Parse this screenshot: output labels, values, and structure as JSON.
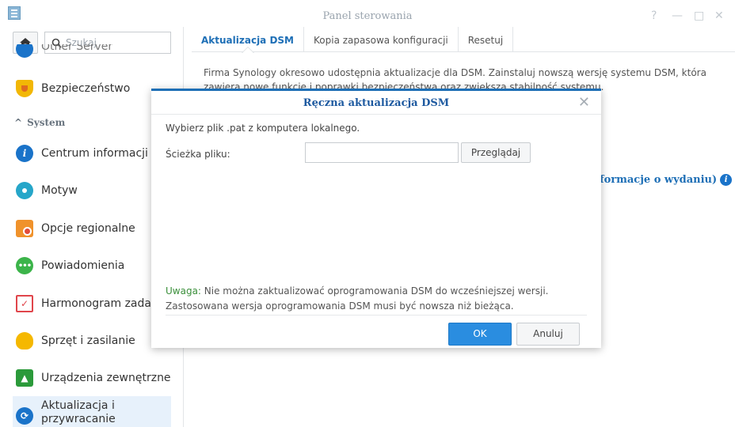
{
  "window": {
    "title": "Panel sterowania",
    "controls": {
      "help": "?",
      "minimize": "—",
      "maximize": "□",
      "close": "✕"
    }
  },
  "sidebar": {
    "search_placeholder": "Szukaj",
    "cut_item": "Other Server",
    "group_system": "System",
    "items": [
      {
        "label": "Bezpieczeństwo",
        "icon": "shield-icon",
        "color": "#f2b705"
      },
      {
        "label": "Centrum informacji",
        "icon": "info-icon",
        "color": "#1a73c9"
      },
      {
        "label": "Motyw",
        "icon": "palette-icon",
        "color": "#26a6c9"
      },
      {
        "label": "Opcje regionalne",
        "icon": "clock-icon",
        "color": "#f0922b"
      },
      {
        "label": "Powiadomienia",
        "icon": "chat-icon",
        "color": "#3cb44a"
      },
      {
        "label": "Harmonogram zadań",
        "icon": "calendar-icon",
        "color": "#e0454b"
      },
      {
        "label": "Sprzęt i zasilanie",
        "icon": "bulb-icon",
        "color": "#f5b800"
      },
      {
        "label": "Urządzenia zewnętrzne",
        "icon": "external-device-icon",
        "color": "#2b9a3a"
      },
      {
        "label": "Aktualizacja i przywracanie",
        "icon": "update-icon",
        "color": "#1a73c9"
      }
    ]
  },
  "main": {
    "tabs": [
      "Aktualizacja DSM",
      "Kopia zapasowa konfiguracji",
      "Resetuj"
    ],
    "description": "Firma Synology okresowo udostępnia aktualizacje dla DSM. Zainstaluj nowszą wersję systemu DSM, która zawiera nowe funkcje i poprawki bezpieczeństwa oraz zwiększa stabilność systemu.",
    "release_notes_link": "formacje o wydaniu)"
  },
  "dialog": {
    "title": "Ręczna aktualizacja DSM",
    "prompt": "Wybierz plik .pat z komputera lokalnego.",
    "path_label": "Ścieżka pliku:",
    "path_value": "",
    "browse": "Przeglądaj",
    "note_label": "Uwaga:",
    "note_line1": " Nie można zaktualizować oprogramowania DSM do wcześniejszej wersji.",
    "note_line2": "Zastosowana wersja oprogramowania DSM musi być nowsza niż bieżąca.",
    "ok": "OK",
    "cancel": "Anuluj"
  }
}
